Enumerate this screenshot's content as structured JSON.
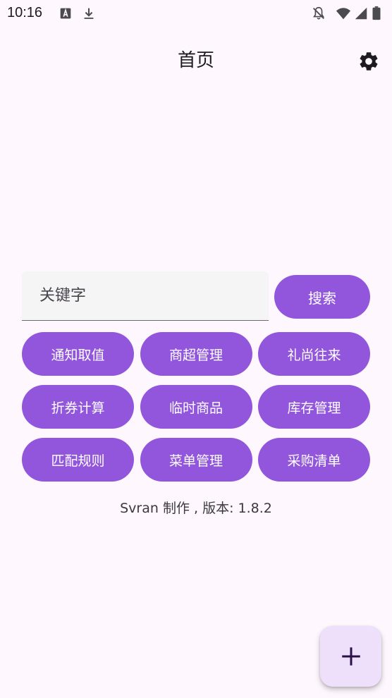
{
  "status_bar": {
    "time": "10:16",
    "icons": [
      "text-a-icon",
      "download-icon",
      "notifications-off-icon",
      "wifi-icon",
      "signal-icon",
      "battery-icon"
    ]
  },
  "app_bar": {
    "title": "首页",
    "settings_icon": "gear-icon"
  },
  "search": {
    "placeholder": "关键字",
    "value": "",
    "button_label": "搜索"
  },
  "buttons": [
    {
      "label": "通知取值"
    },
    {
      "label": "商超管理"
    },
    {
      "label": "礼尚往来"
    },
    {
      "label": "折券计算"
    },
    {
      "label": "临时商品"
    },
    {
      "label": "库存管理"
    },
    {
      "label": "匹配规则"
    },
    {
      "label": "菜单管理"
    },
    {
      "label": "采购清单"
    }
  ],
  "footer": {
    "version_text": "Svran 制作 , 版本: 1.8.2"
  },
  "fab": {
    "icon": "plus-icon"
  },
  "colors": {
    "background": "#FEF7FE",
    "accent": "#9256DC",
    "fab_background": "#EEDFFB",
    "input_background": "#F5F5F5"
  }
}
